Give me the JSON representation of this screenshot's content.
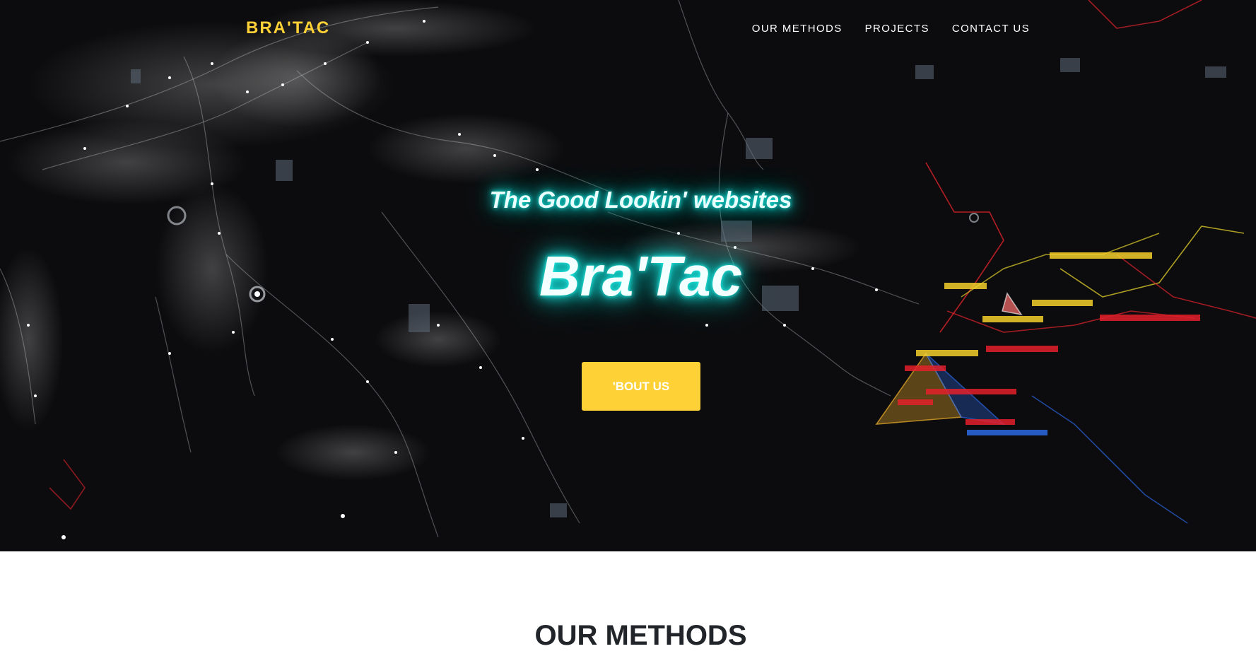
{
  "navbar": {
    "brand": "BRA'TAC",
    "links": [
      "OUR METHODS",
      "PROJECTS",
      "CONTACT US"
    ]
  },
  "hero": {
    "lead": "The Good Lookin' websites",
    "heading": "Bra'Tac",
    "button_label": "'BOUT US"
  },
  "section": {
    "heading": "OUR METHODS"
  },
  "colors": {
    "accent": "#fed136",
    "glow": "#19e8e0",
    "hero_bg": "#0b0b0d",
    "heading_text": "#212529"
  }
}
